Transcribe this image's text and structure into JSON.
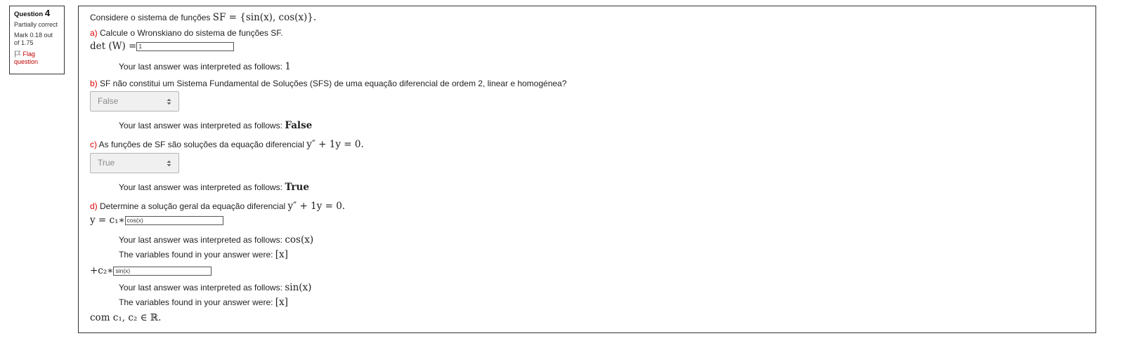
{
  "info": {
    "question_label": "Question",
    "question_number": "4",
    "state": "Partially correct",
    "grade": "Mark 0.18 out of 1.75",
    "flag_label": "Flag question"
  },
  "content": {
    "intro_text": "Considere o sistema de funções ",
    "intro_math": "SF = {sin(x), cos(x)}.",
    "part_a": {
      "letter": "a)",
      "text": " Calcule o Wronskiano do sistema de funções SF.",
      "prefix_math": "det (W) =",
      "input_value": "1",
      "feedback_label": "Your last answer was interpreted as follows: ",
      "feedback_math": "1"
    },
    "part_b": {
      "letter": "b)",
      "text": " SF não constitui um Sistema Fundamental de Soluções (SFS) de uma equação diferencial de ordem 2, linear e homogénea?",
      "select_value": "False",
      "feedback_label": "Your last answer was interpreted as follows: ",
      "feedback_math": "False"
    },
    "part_c": {
      "letter": "c)",
      "text": " As funções de SF são soluções da equação diferencial ",
      "equation": "y″ + 1y = 0.",
      "select_value": "True",
      "feedback_label": "Your last answer was interpreted as follows: ",
      "feedback_math": "True"
    },
    "part_d": {
      "letter": "d)",
      "text": " Determine a solução geral da equação diferencial ",
      "equation": "y″ + 1y = 0.",
      "prefix1_math": "y = c₁∗",
      "input1_value": "cos(x)",
      "feedback1_label": "Your last answer was interpreted as follows: ",
      "feedback1_math": "cos(x)",
      "variables1_label": "The variables found in your answer were: ",
      "variables1_math": "[x]",
      "prefix2_math": "+c₂∗",
      "input2_value": "sin(x)",
      "feedback2_label": "Your last answer was interpreted as follows: ",
      "feedback2_math": "sin(x)",
      "variables2_label": "The variables found in your answer were: ",
      "variables2_math": "[x]",
      "closing_math": "com c₁, c₂ ∈ ℝ."
    }
  }
}
